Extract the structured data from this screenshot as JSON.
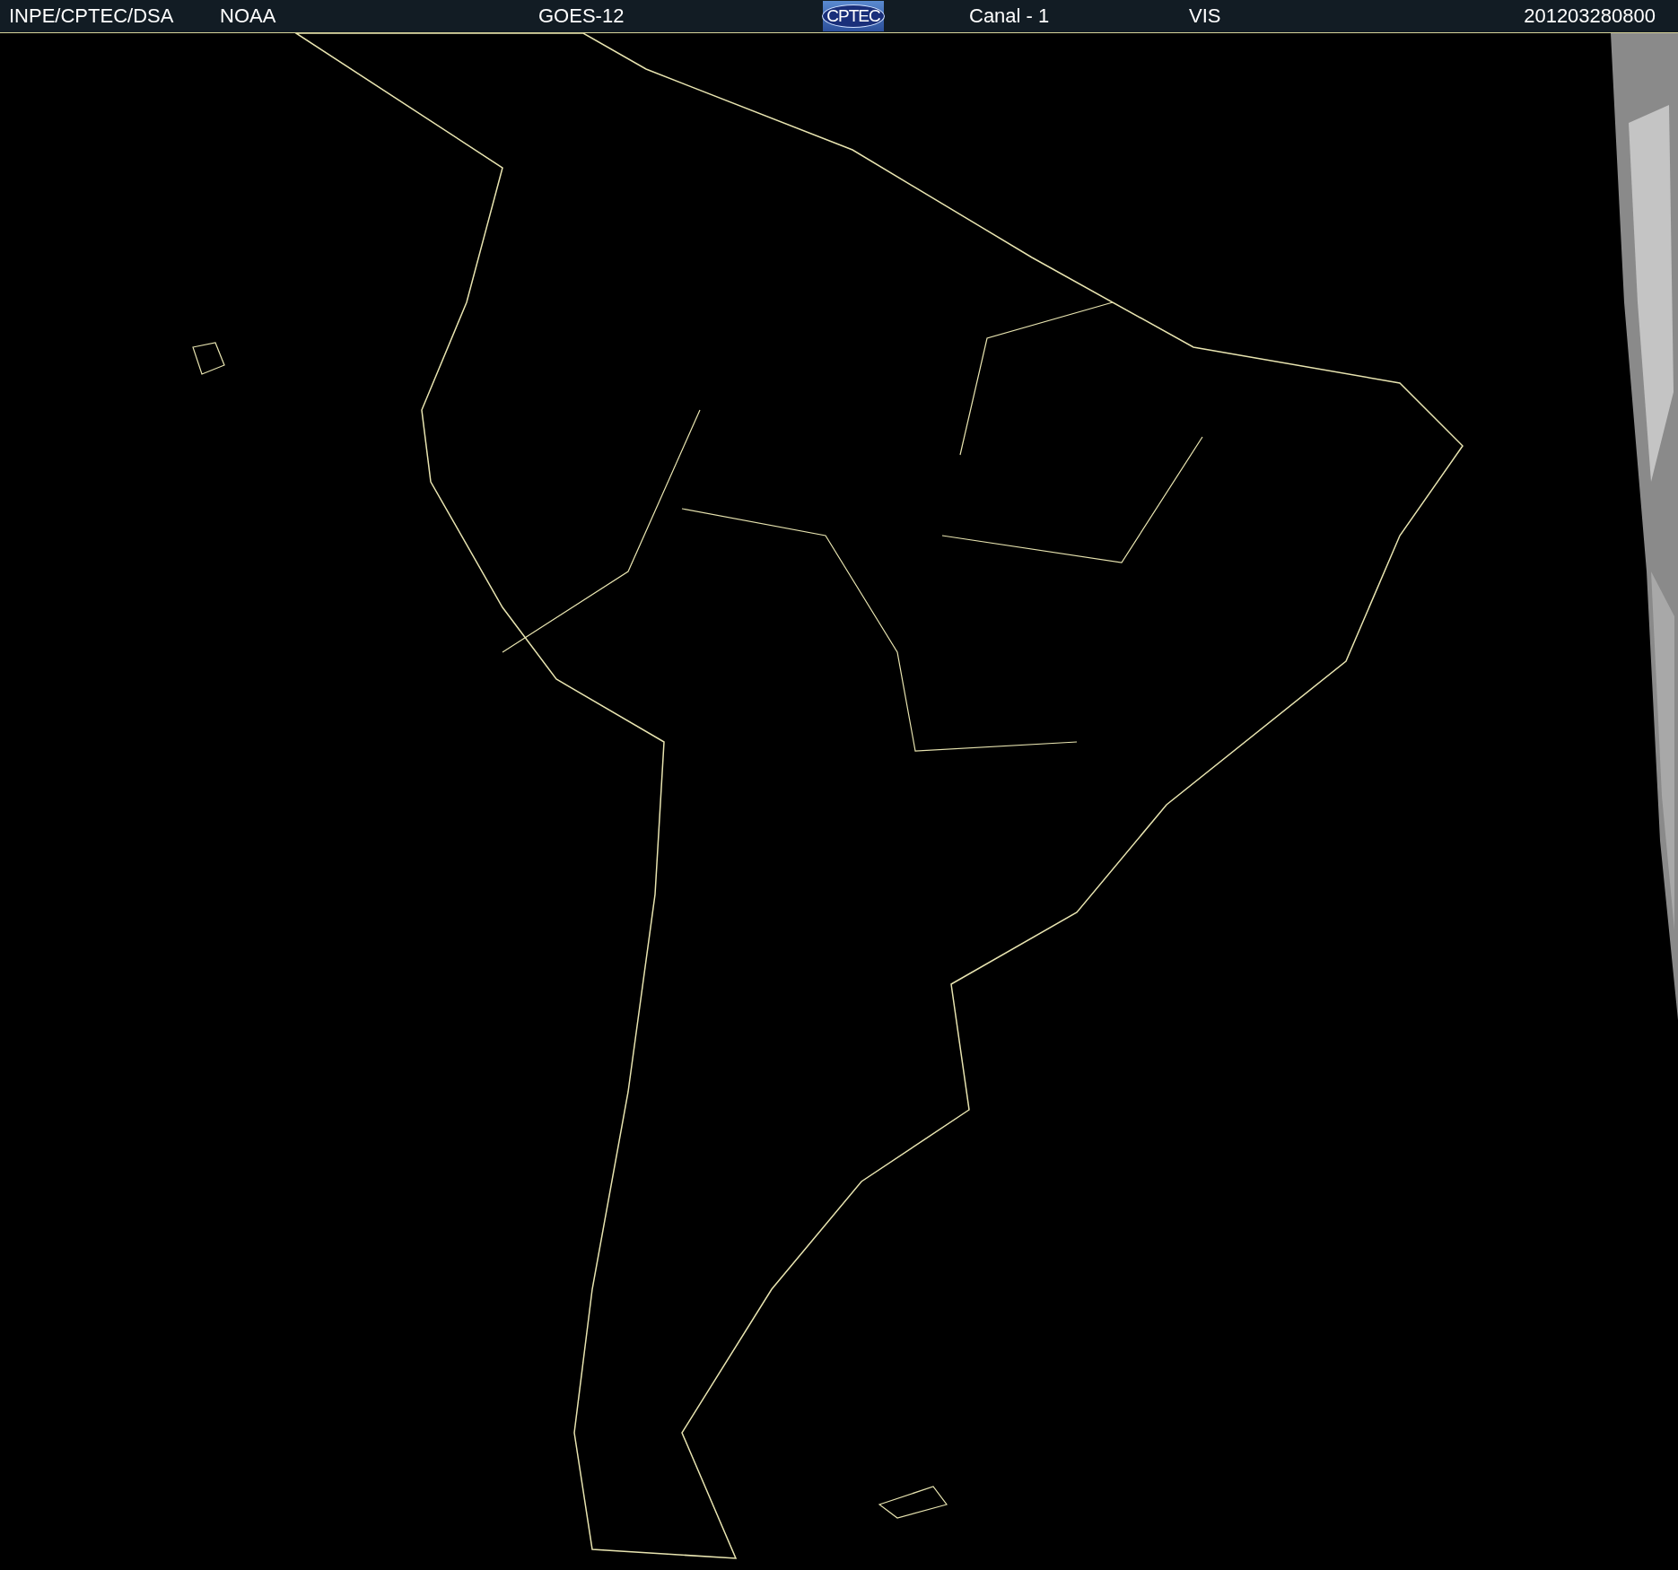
{
  "header": {
    "labels": [
      "INPE/CPTEC/DSA",
      "NOAA",
      "GOES-12"
    ],
    "logo": "CPTEC",
    "channel": "Canal - 1",
    "band": "VIS",
    "timestamp": "201203280800"
  }
}
